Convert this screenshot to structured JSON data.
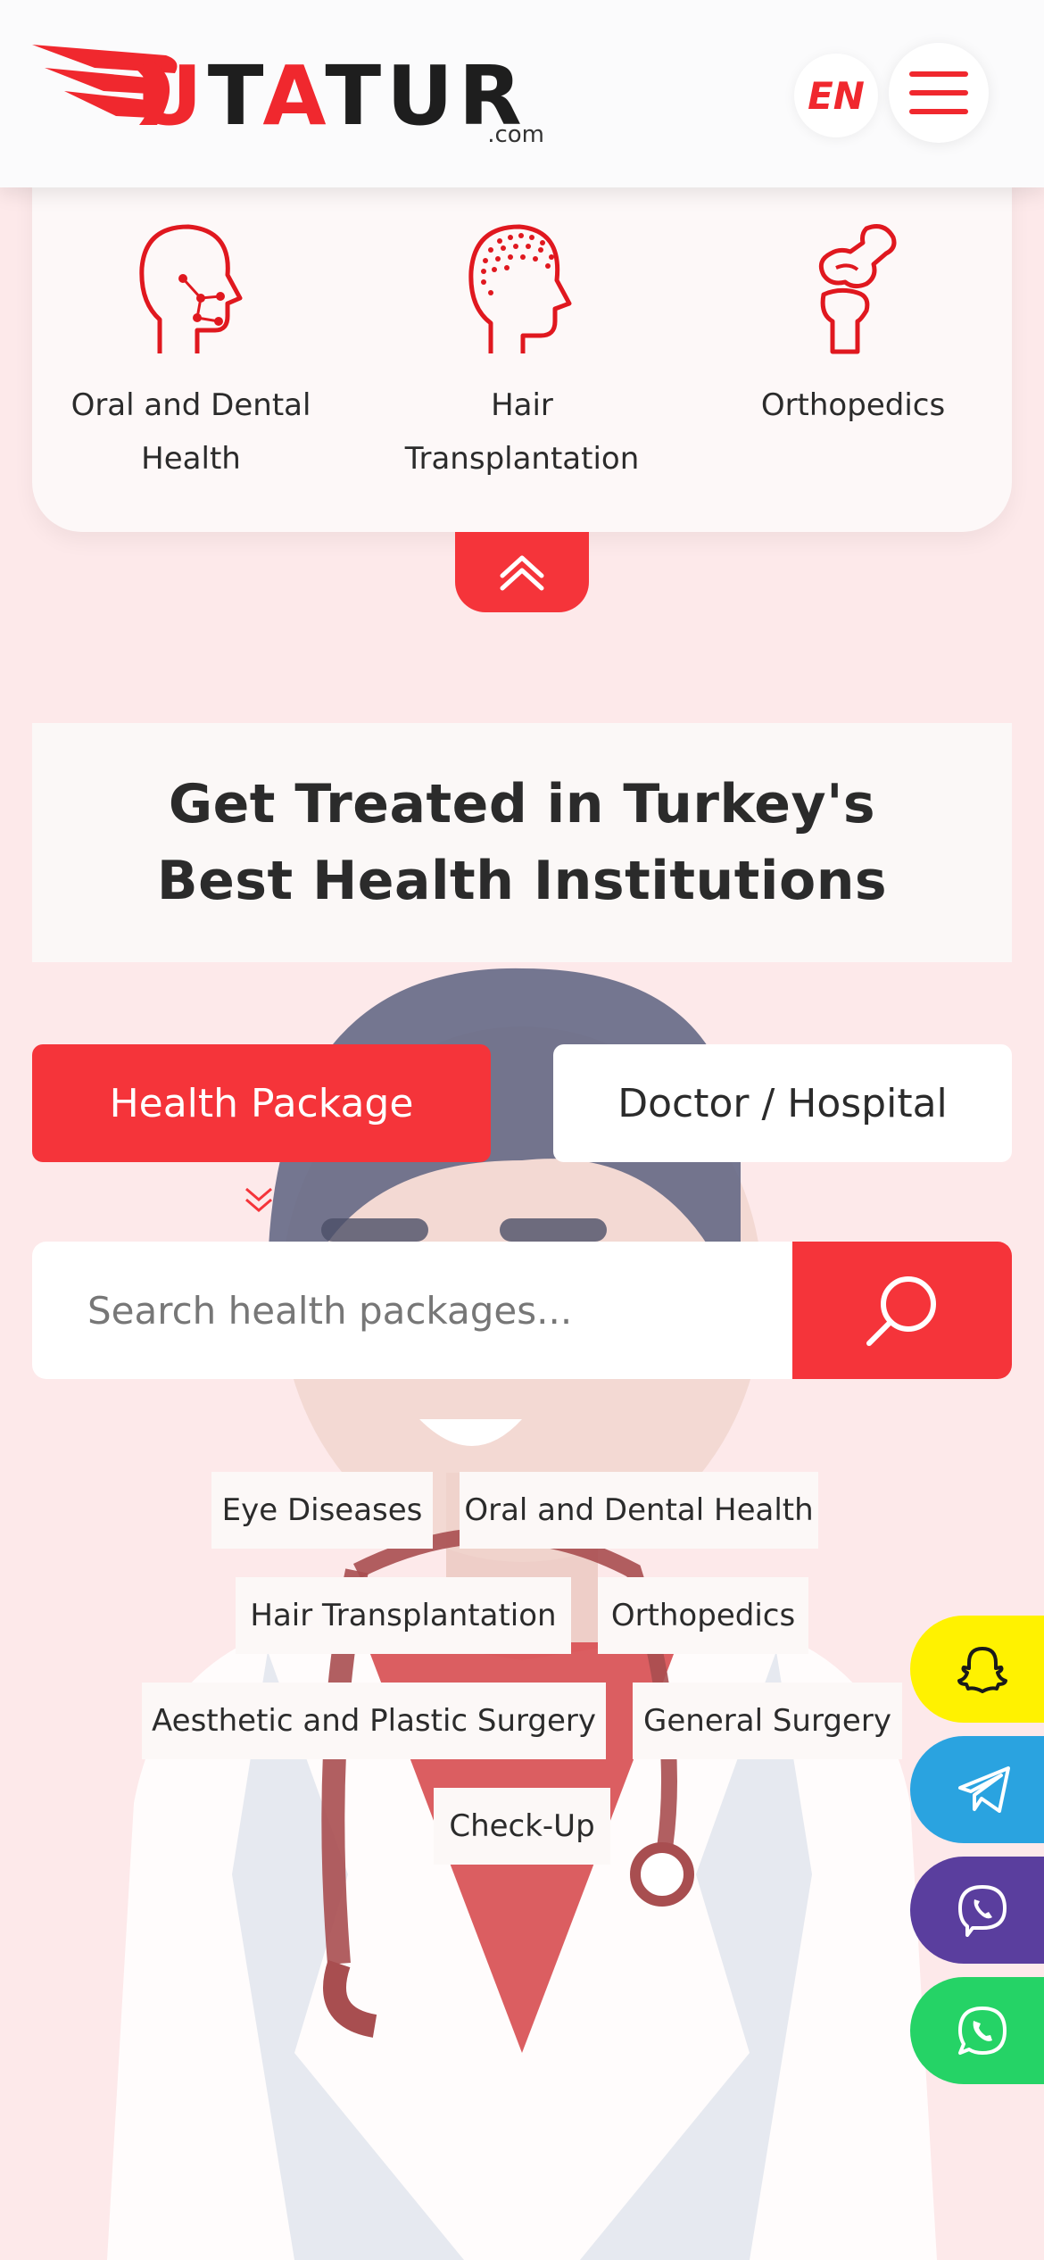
{
  "brand": {
    "logo_main": "UTATUR",
    "logo_sub": ".com"
  },
  "header": {
    "language": "EN",
    "menu_icon": "hamburger-menu-icon"
  },
  "categories": [
    {
      "label": "Oral and Dental Health",
      "icon": "head-dental-icon"
    },
    {
      "label": "Hair Transplantation",
      "icon": "head-hair-icon"
    },
    {
      "label": "Orthopedics",
      "icon": "knee-joint-icon"
    }
  ],
  "collapse_icon": "double-chevron-up-icon",
  "headline": "Get Treated in Turkey's Best Health Institutions",
  "tabs": {
    "active": "Health Package",
    "inactive": "Doctor / Hospital"
  },
  "search": {
    "placeholder": "Search health packages...",
    "button_icon": "search-icon"
  },
  "tags": [
    "Eye Diseases",
    "Oral and Dental Health",
    "Hair Transplantation",
    "Orthopedics",
    "Aesthetic and Plastic Surgery",
    "General Surgery",
    "Check-Up"
  ],
  "social": [
    {
      "name": "snapchat",
      "color": "#fff200"
    },
    {
      "name": "telegram",
      "color": "#2aa3e0"
    },
    {
      "name": "viber",
      "color": "#5a3e9e"
    },
    {
      "name": "whatsapp",
      "color": "#25d366"
    }
  ],
  "colors": {
    "accent": "#f5343a",
    "page_bg": "#fde9ea"
  }
}
